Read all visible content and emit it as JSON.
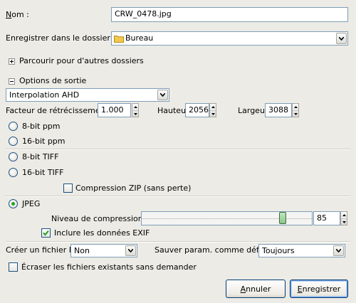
{
  "nom": {
    "label": "Nom :",
    "value": "CRW_0478.jpg"
  },
  "folder": {
    "label": "Enregistrer dans le dossier :",
    "value": "Bureau"
  },
  "browse": {
    "label": "Parcourir pour d'autres dossiers"
  },
  "output": {
    "label": "Options de sortie",
    "interpolation": "Interpolation AHD",
    "shrink_label": "Facteur de rétrécissement",
    "shrink_value": "1.000",
    "height_label": "Hauteur",
    "height_value": "2056",
    "width_label": "Largeur",
    "width_value": "3088"
  },
  "formats": {
    "ppm8": "8-bit ppm",
    "ppm16": "16-bit ppm",
    "tiff8": "8-bit TIFF",
    "tiff16": "16-bit TIFF",
    "zip": "Compression ZIP (sans perte)",
    "jpeg": "JPEG",
    "selected": "JPEG"
  },
  "jpeg": {
    "compression_label": "Niveau de compression",
    "compression_value": "85",
    "exif_label": "Inclure les données EXIF",
    "exif_checked": true
  },
  "idfile": {
    "label": "Créer un fichier ID",
    "value": "Non"
  },
  "save_params": {
    "label": "Sauver param. comme défaut",
    "value": "Toujours"
  },
  "overwrite": {
    "label": "Écraser les fichiers existants sans demander",
    "checked": false
  },
  "buttons": {
    "cancel": "Annuler",
    "save": "Enregistrer"
  },
  "colors": {
    "radio_selected": "#21a121",
    "folder_icon": "#f2c94c",
    "check_mark": "#21a121",
    "slider_thumb": "#8bc58b"
  }
}
